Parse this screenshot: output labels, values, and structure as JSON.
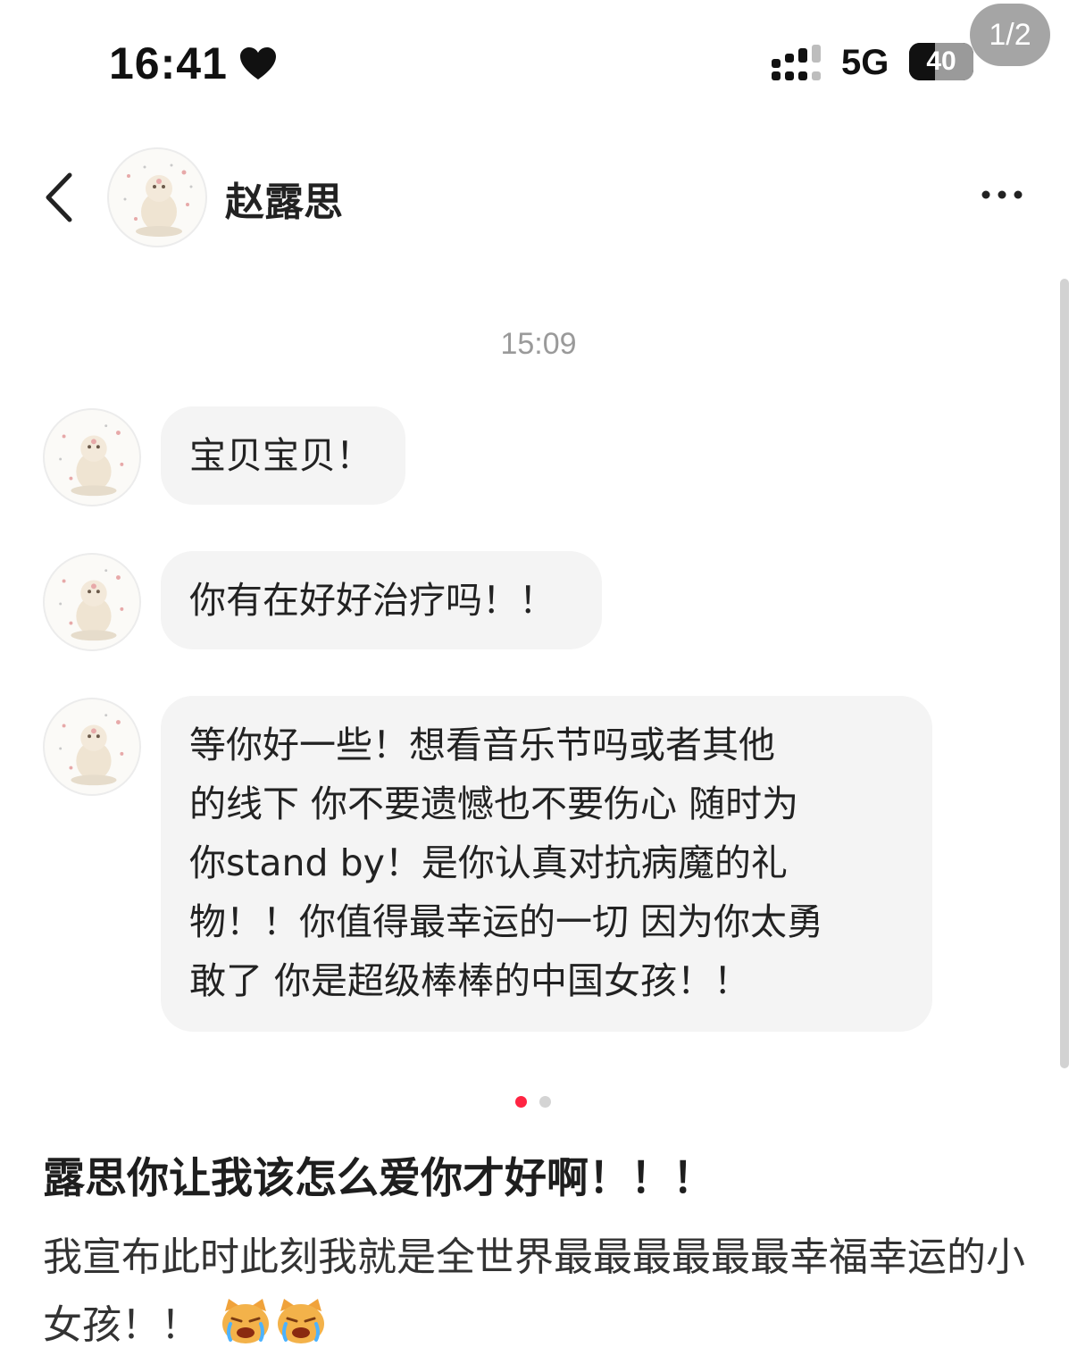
{
  "status_bar": {
    "time": "16:41",
    "network": "5G",
    "battery_level": "40",
    "battery_fraction": 0.4,
    "heart_icon": "heart-icon",
    "signal_icon": "signal-bars-icon"
  },
  "page_indicator": "1/2",
  "header": {
    "contact_name": "赵露思",
    "back_icon": "chevron-left-icon",
    "more_icon": "ellipsis-icon",
    "avatar_icon": "puppy-avatar-icon"
  },
  "chat": {
    "timestamp": "15:09",
    "messages": [
      {
        "text": "宝贝宝贝！"
      },
      {
        "text": "你有在好好治疗吗！！"
      },
      {
        "text": "等你好一些！想看音乐节吗或者其他\n的线下 你不要遗憾也不要伤心 随时为\n你stand by！是你认真对抗病魔的礼\n物！！你值得最幸运的一切 因为你太勇\n敢了 你是超级棒棒的中国女孩！！"
      }
    ]
  },
  "carousel": {
    "total": 2,
    "active": 1,
    "active_color": "#ff2442"
  },
  "post": {
    "title": "露思你让我该怎么爱你才好啊！！！",
    "body": "我宣布此时此刻我就是全世界最最最最最最幸福幸运的小女孩！！",
    "emoji_icons": [
      "crying-cat-emoji",
      "crying-cat-emoji"
    ]
  }
}
